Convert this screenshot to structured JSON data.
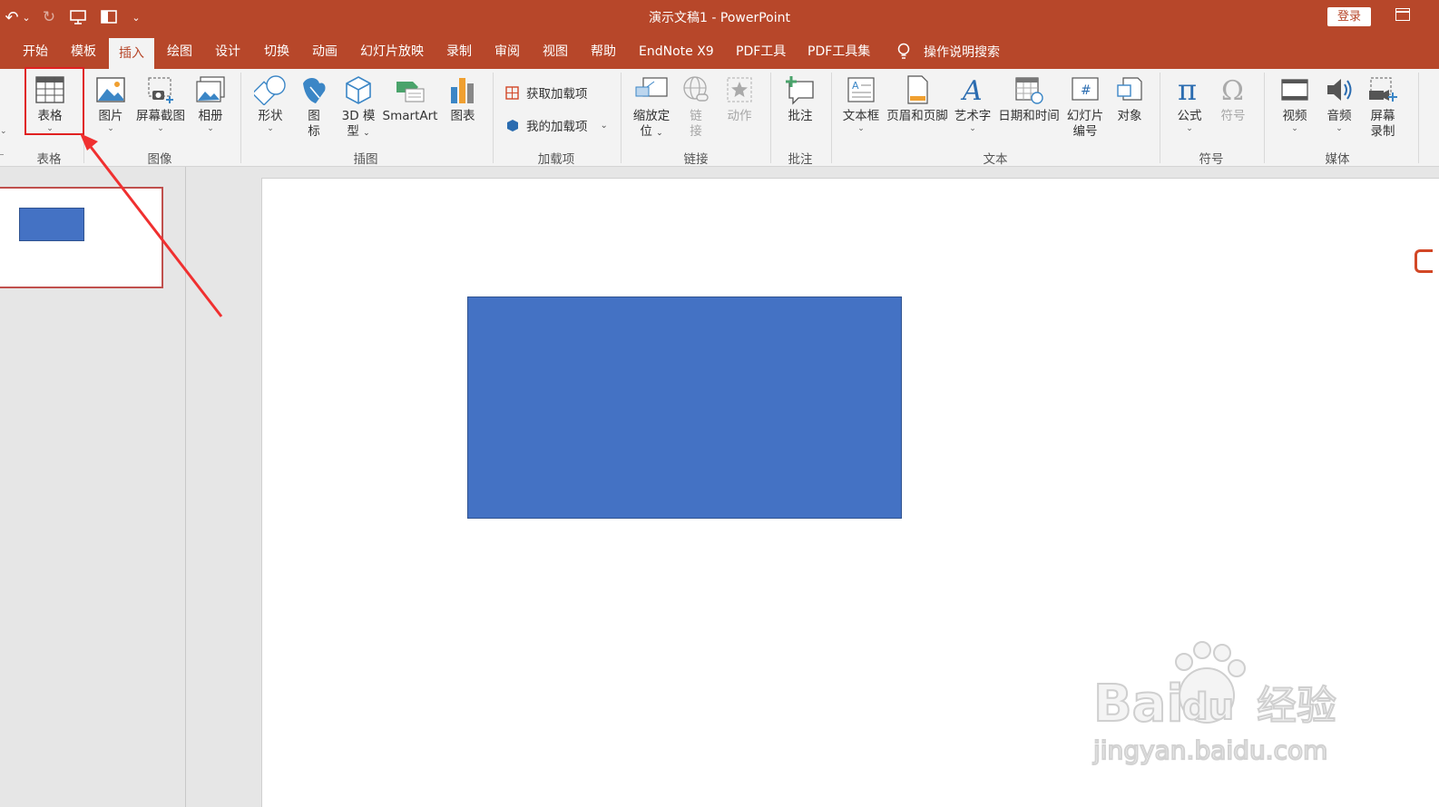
{
  "window": {
    "title": "演示文稿1  -  PowerPoint",
    "login_label": "登录"
  },
  "qat": {
    "undo": "↶",
    "dropdown": "⌄",
    "redo": "↻",
    "more": "⌄"
  },
  "tabs": [
    {
      "label": "开始"
    },
    {
      "label": "模板"
    },
    {
      "label": "插入",
      "active": true
    },
    {
      "label": "绘图"
    },
    {
      "label": "设计"
    },
    {
      "label": "切换"
    },
    {
      "label": "动画"
    },
    {
      "label": "幻灯片放映"
    },
    {
      "label": "录制"
    },
    {
      "label": "审阅"
    },
    {
      "label": "视图"
    },
    {
      "label": "帮助"
    },
    {
      "label": "EndNote X9"
    },
    {
      "label": "PDF工具"
    },
    {
      "label": "PDF工具集"
    }
  ],
  "tell_me": {
    "label": "操作说明搜索",
    "icon": "lightbulb-icon"
  },
  "ribbon": {
    "table": {
      "label": "表格",
      "group": "表格"
    },
    "images": {
      "picture": "图片",
      "screenshot": "屏幕截图",
      "album": "相册",
      "group": "图像"
    },
    "illustrations": {
      "shapes": "形状",
      "icons_1": "图",
      "icons_2": "标",
      "model_1": "3D 模",
      "model_2": "型",
      "smartart": "SmartArt",
      "chart": "图表",
      "group": "插图"
    },
    "addins": {
      "get": "获取加载项",
      "mine": "我的加载项",
      "group": "加载项"
    },
    "links": {
      "zoom_1": "缩放定",
      "zoom_2": "位",
      "link_1": "链",
      "link_2": "接",
      "action": "动作",
      "group": "链接"
    },
    "comments": {
      "comment": "批注",
      "group": "批注"
    },
    "text": {
      "textbox": "文本框",
      "header_footer": "页眉和页脚",
      "wordart": "艺术字",
      "datetime": "日期和时间",
      "slide_no_1": "幻灯片",
      "slide_no_2": "编号",
      "object": "对象",
      "group": "文本"
    },
    "symbols": {
      "equation": "公式",
      "symbol": "符号",
      "group": "符号"
    },
    "media": {
      "video": "视频",
      "audio": "音频",
      "screen_rec_1": "屏幕",
      "screen_rec_2": "录制",
      "group": "媒体"
    }
  },
  "watermark": {
    "brand": "Bai",
    "brand2": "du",
    "cn": "经验",
    "url": "jingyan.baidu.com"
  },
  "colors": {
    "accent": "#b7472a",
    "shape_fill": "#4472c4",
    "annotation": "#e02020"
  }
}
